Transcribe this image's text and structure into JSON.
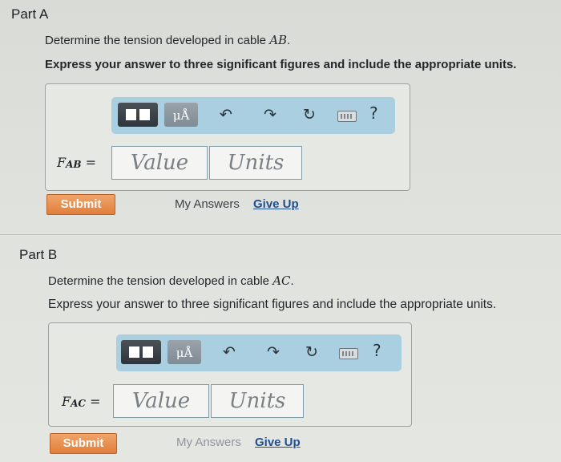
{
  "parts": [
    {
      "title": "Part A",
      "prompt_prefix": "Determine the tension developed in cable ",
      "cable": "AB",
      "prompt_suffix": ".",
      "instruction": "Express your answer to three significant figures and include the appropriate units.",
      "label_var": "F",
      "label_sub": "AB",
      "label_eq": "=",
      "value_placeholder": "Value",
      "units_placeholder": "Units",
      "submit_label": "Submit",
      "my_answers_label": "My Answers",
      "give_up_label": "Give Up"
    },
    {
      "title": "Part B",
      "prompt_prefix": "Determine the tension developed in cable ",
      "cable": "AC",
      "prompt_suffix": ".",
      "instruction": "Express your answer to three significant figures and include the appropriate units.",
      "label_var": "F",
      "label_sub": "AC",
      "label_eq": "=",
      "value_placeholder": "Value",
      "units_placeholder": "Units",
      "submit_label": "Submit",
      "my_answers_label": "My Answers",
      "give_up_label": "Give Up"
    }
  ],
  "toolbar": {
    "units_button_label": "μÅ",
    "help_label": "?",
    "undo_icon": "↶",
    "redo_icon": "↷",
    "reset_icon": "↻"
  },
  "colors": {
    "toolbar_bg": "#a9cfe1",
    "submit_bg": "#e68b47",
    "link_blue": "#1f4f91"
  }
}
